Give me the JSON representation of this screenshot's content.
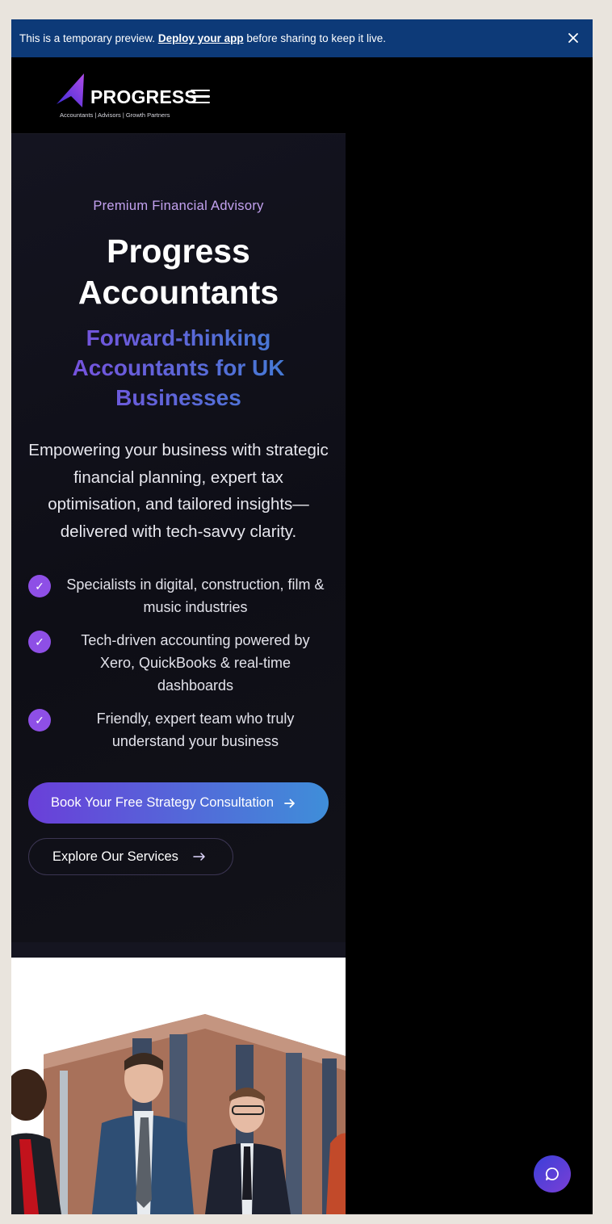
{
  "banner": {
    "text_before": "This is a temporary preview. ",
    "link": "Deploy your app",
    "text_after": " before sharing to keep it live.",
    "close_icon": "close-icon"
  },
  "header": {
    "logo_word": "PROGRESS",
    "logo_tagline": "Accountants | Advisors | Growth Partners",
    "menu_icon": "hamburger-icon"
  },
  "hero": {
    "eyebrow": "Premium Financial Advisory",
    "title_line1": "Progress",
    "title_line2": "Accountants",
    "subtitle": "Forward-thinking Accountants for UK Businesses",
    "lead": "Empowering your business with strategic financial planning, expert tax optimisation, and tailored insights—delivered with tech-savvy clarity.",
    "features": [
      {
        "icon": "check-icon",
        "text": "Specialists in digital, construction, film & music industries"
      },
      {
        "icon": "check-icon",
        "text": "Tech-driven accounting powered by Xero, QuickBooks & real-time dashboards"
      },
      {
        "icon": "check-icon",
        "text": "Friendly, expert team who truly understand your business"
      }
    ],
    "cta_primary": "Book Your Free Strategy Consultation",
    "cta_secondary": "Explore Our Services"
  },
  "chat": {
    "icon": "chat-bubble-icon"
  },
  "colors": {
    "banner": "#0d3a78",
    "accent_purple": "#8e4fe6",
    "accent_blue": "#3f8ed9",
    "eyebrow": "#c3a2f0"
  }
}
